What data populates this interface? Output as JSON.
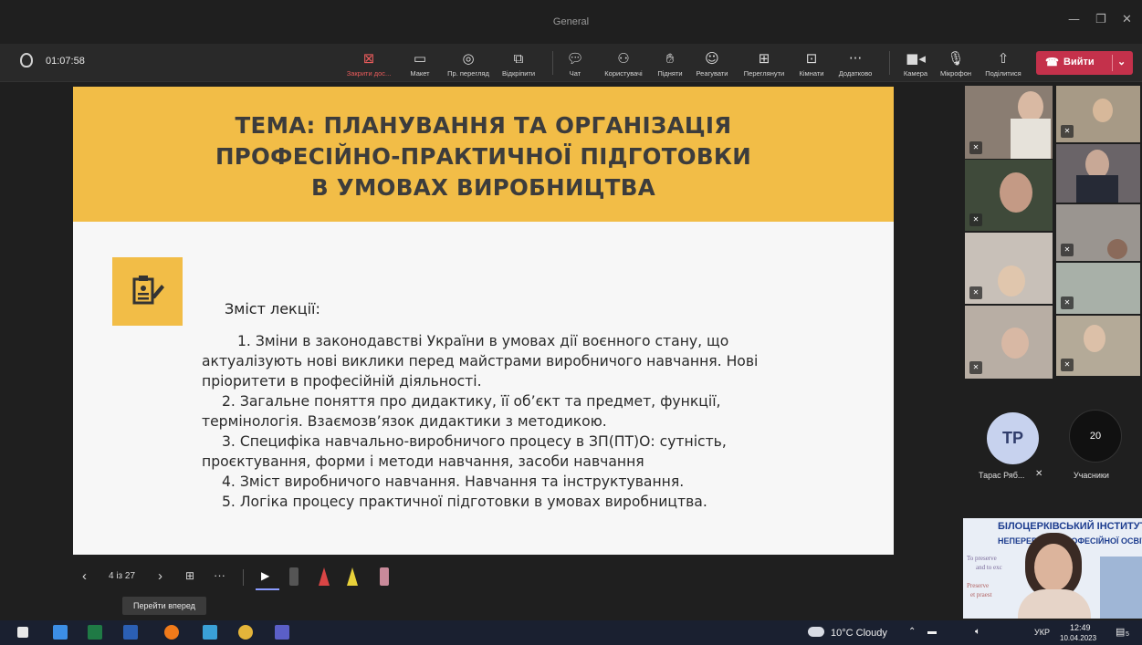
{
  "window": {
    "title": "General"
  },
  "meeting": {
    "elapsed": "01:07:58",
    "toolbar": {
      "stop_share": "Закрити дос...",
      "layout": "Макет",
      "presenter_view": "Пр. перегляд",
      "undock": "Відкріпити",
      "chat": "Чат",
      "people": "Користувачі",
      "raise": "Підняти",
      "react": "Реагувати",
      "view": "Переглянути",
      "rooms": "Кімнати",
      "more": "Додатково",
      "camera": "Камера",
      "mic": "Мікрофон",
      "share": "Поділитися",
      "leave": "Вийти"
    }
  },
  "slide": {
    "title_lines": [
      "ТЕМА: ПЛАНУВАННЯ ТА ОРГАНІЗАЦІЯ",
      "ПРОФЕСІЙНО-ПРАКТИЧНОЇ ПІДГОТОВКИ",
      "В УМОВАХ ВИРОБНИЦТВА"
    ],
    "section_title": "Зміст лекції:",
    "body_lines": [
      "1.  Зміни в законодавстві України в умовах дії воєнного стану, що",
      "актуалізують нові виклики перед майстрами виробничого навчання. Нові",
      "пріоритети в професійній діяльності.",
      "2. Загальне поняття про дидактику, її об’єкт та предмет, функції,",
      "термінологія. Взаємозв’язок дидактики з методикою.",
      "3. Специфіка навчально-виробничого процесу в ЗП(ПТ)О: сутність,",
      "проєктування, форми і методи навчання, засоби навчання",
      "4. Зміст виробничого навчання. Навчання та інструктування.",
      "5. Логіка процесу практичної підготовки в умовах виробництва."
    ]
  },
  "slide_controls": {
    "page": "4 із 27",
    "tooltip": "Перейти вперед"
  },
  "participants": {
    "avatar_initials": "TP",
    "avatar_name": "Тарас Ряб...",
    "count": "20",
    "count_label": "Учасники"
  },
  "institute": {
    "line1": "БІЛОЦЕРКІВСЬКИЙ ІНСТИТУТ",
    "line2": "НЕПЕРЕРВНОЇ ПРОФЕСІЙНОЇ ОСВІТИ",
    "motto1": "To preserve",
    "motto2": "and to exc",
    "motto3": "Preserve",
    "motto4": "et praest"
  },
  "taskbar": {
    "weather": "10°C  Cloudy",
    "lang": "УКР",
    "time": "12:49",
    "date": "10.04.2023",
    "notif": "5"
  },
  "colors": {
    "slide_accent": "#f2bd47",
    "leave_button": "#c4314b",
    "stop_share": "#e85b5b"
  }
}
